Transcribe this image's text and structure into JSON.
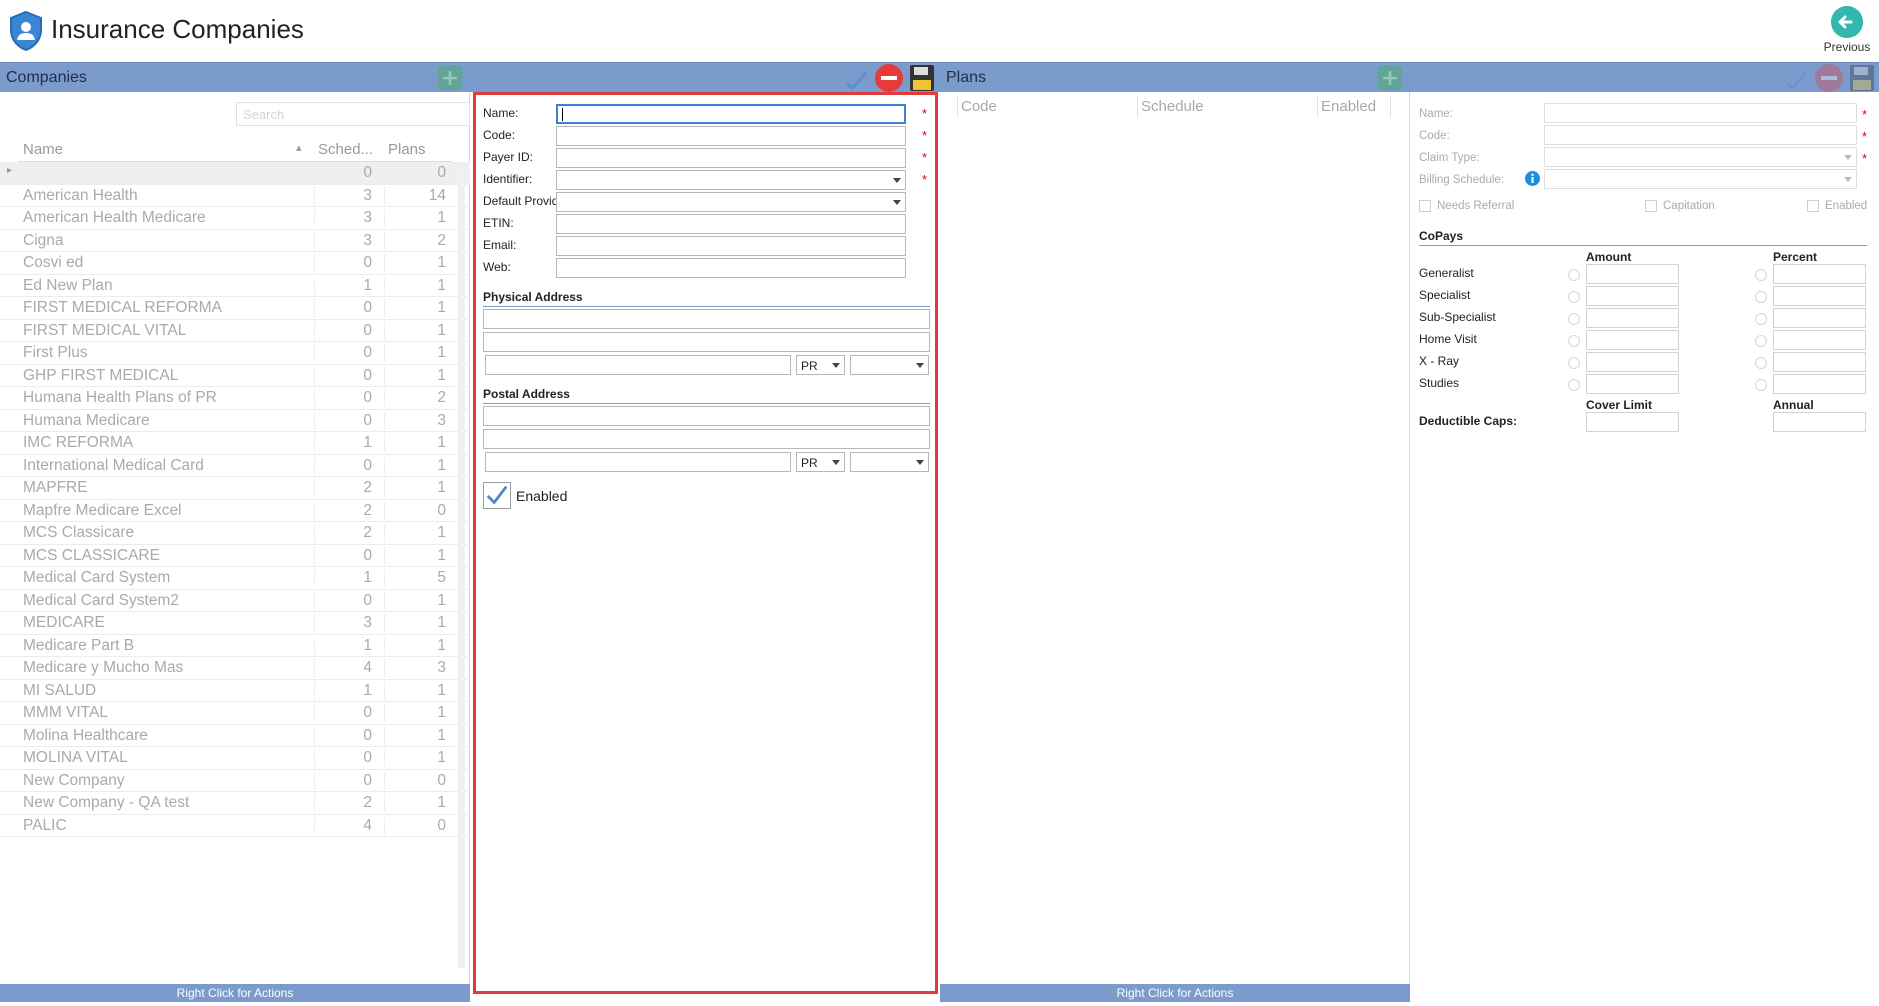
{
  "title": "Insurance Companies",
  "previous": {
    "label": "Previous",
    "icon": "arrow-left-icon"
  },
  "colors": {
    "header_bar": "#7b9bcc",
    "accent": "#34b7ac",
    "highlight_border": "#e23b3b",
    "required": "#e00000"
  },
  "companies": {
    "header": "Companies",
    "search_placeholder": "Search",
    "columns": [
      "Name",
      "Sched...",
      "Plans"
    ],
    "rows": [
      {
        "name": "",
        "sched": "0",
        "plans": "0"
      },
      {
        "name": "American Health",
        "sched": "3",
        "plans": "14"
      },
      {
        "name": "American Health Medicare",
        "sched": "3",
        "plans": "1"
      },
      {
        "name": "Cigna",
        "sched": "3",
        "plans": "2"
      },
      {
        "name": "Cosvi ed",
        "sched": "0",
        "plans": "1"
      },
      {
        "name": "Ed New Plan",
        "sched": "1",
        "plans": "1"
      },
      {
        "name": "FIRST MEDICAL REFORMA",
        "sched": "0",
        "plans": "1"
      },
      {
        "name": "FIRST MEDICAL VITAL",
        "sched": "0",
        "plans": "1"
      },
      {
        "name": "First Plus",
        "sched": "0",
        "plans": "1"
      },
      {
        "name": "GHP FIRST MEDICAL",
        "sched": "0",
        "plans": "1"
      },
      {
        "name": "Humana Health Plans of PR",
        "sched": "0",
        "plans": "2"
      },
      {
        "name": "Humana Medicare",
        "sched": "0",
        "plans": "3"
      },
      {
        "name": "IMC REFORMA",
        "sched": "1",
        "plans": "1"
      },
      {
        "name": "International Medical Card",
        "sched": "0",
        "plans": "1"
      },
      {
        "name": "MAPFRE",
        "sched": "2",
        "plans": "1"
      },
      {
        "name": "Mapfre Medicare Excel",
        "sched": "2",
        "plans": "0"
      },
      {
        "name": "MCS Classicare",
        "sched": "2",
        "plans": "1"
      },
      {
        "name": "MCS CLASSICARE",
        "sched": "0",
        "plans": "1"
      },
      {
        "name": "Medical Card System",
        "sched": "1",
        "plans": "5"
      },
      {
        "name": "Medical Card System2",
        "sched": "0",
        "plans": "1"
      },
      {
        "name": "MEDICARE",
        "sched": "3",
        "plans": "1"
      },
      {
        "name": "Medicare Part B",
        "sched": "1",
        "plans": "1"
      },
      {
        "name": "Medicare y Mucho Mas",
        "sched": "4",
        "plans": "3"
      },
      {
        "name": "MI SALUD",
        "sched": "1",
        "plans": "1"
      },
      {
        "name": "MMM VITAL",
        "sched": "0",
        "plans": "1"
      },
      {
        "name": "Molina Healthcare",
        "sched": "0",
        "plans": "1"
      },
      {
        "name": "MOLINA VITAL",
        "sched": "0",
        "plans": "1"
      },
      {
        "name": "New Company",
        "sched": "0",
        "plans": "0"
      },
      {
        "name": "New Company - QA test",
        "sched": "2",
        "plans": "1"
      },
      {
        "name": "PALIC",
        "sched": "4",
        "plans": "0"
      }
    ],
    "footer": "Right Click for Actions"
  },
  "company_form": {
    "fields": {
      "name": "Name:",
      "code": "Code:",
      "payer_id": "Payer ID:",
      "identifier": "Identifier:",
      "default_provider": "Default Provider:",
      "etin": "ETIN:",
      "email": "Email:",
      "web": "Web:"
    },
    "required_mark": "*",
    "physical_address": "Physical Address",
    "postal_address": "Postal Address",
    "state_value": "PR",
    "enabled_label": "Enabled"
  },
  "plans": {
    "header": "Plans",
    "columns": [
      "Code",
      "Schedule",
      "Enabled"
    ],
    "footer": "Right Click for Actions"
  },
  "plan_form": {
    "name": "Name:",
    "code": "Code:",
    "claim_type": "Claim Type:",
    "billing_schedule": "Billing Schedule:",
    "needs_referral": "Needs Referral",
    "capitation": "Capitation",
    "enabled": "Enabled",
    "copays_title": "CoPays",
    "amount": "Amount",
    "percent": "Percent",
    "copays": [
      "Generalist",
      "Specialist",
      "Sub-Specialist",
      "Home Visit",
      "X - Ray",
      "Studies"
    ],
    "cover_limit": "Cover Limit",
    "annual": "Annual",
    "deductible_caps": "Deductible Caps:"
  }
}
